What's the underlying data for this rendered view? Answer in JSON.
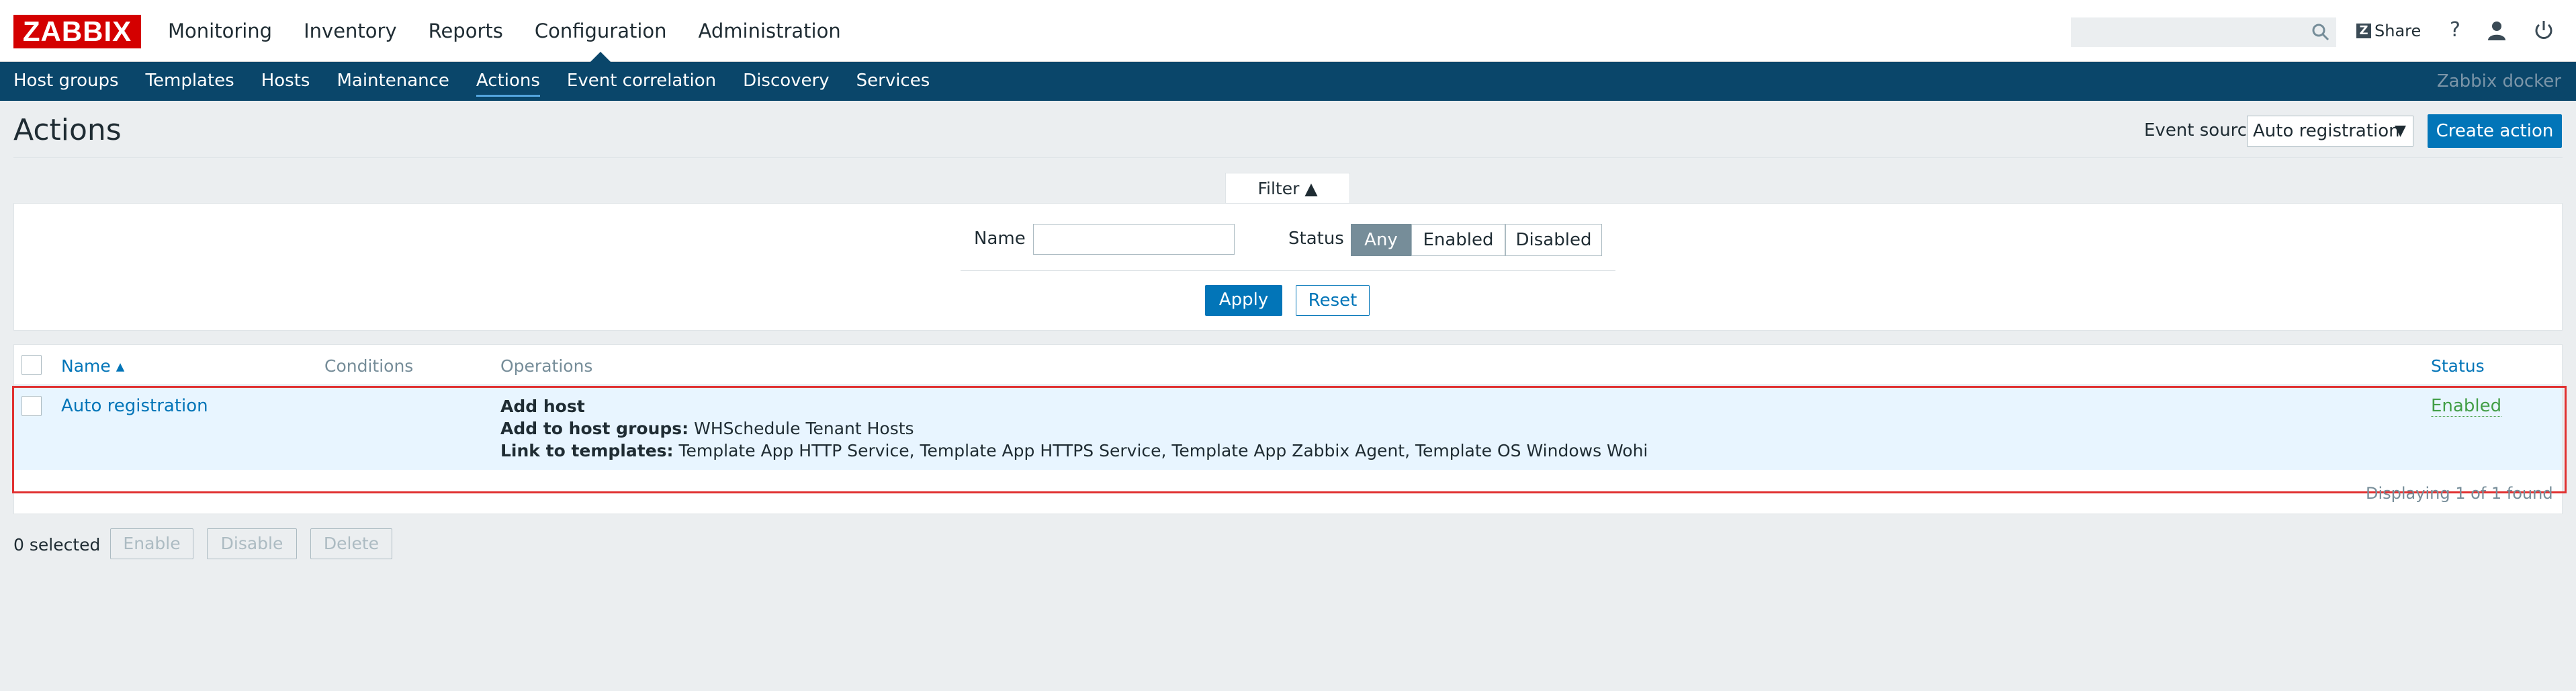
{
  "header": {
    "logo": "ZABBIX",
    "main_nav": [
      "Monitoring",
      "Inventory",
      "Reports",
      "Configuration",
      "Administration"
    ],
    "active_main": "Configuration",
    "search_value": "",
    "share_label": "Share",
    "help_label": "?"
  },
  "sub_nav": {
    "items": [
      "Host groups",
      "Templates",
      "Hosts",
      "Maintenance",
      "Actions",
      "Event correlation",
      "Discovery",
      "Services"
    ],
    "active": "Actions",
    "server_name": "Zabbix docker"
  },
  "page": {
    "title": "Actions",
    "event_source_label": "Event source",
    "event_source_value": "Auto registration",
    "create_button": "Create action"
  },
  "filter": {
    "tab_label": "Filter ▲",
    "name_label": "Name",
    "name_value": "",
    "status_label": "Status",
    "status_options": [
      "Any",
      "Enabled",
      "Disabled"
    ],
    "status_selected": "Any",
    "apply_label": "Apply",
    "reset_label": "Reset"
  },
  "table": {
    "columns": {
      "name": "Name ▴",
      "conditions": "Conditions",
      "operations": "Operations",
      "status": "Status"
    },
    "rows": [
      {
        "name": "Auto registration",
        "conditions": "",
        "op1_label": "Add host",
        "op2_label": "Add to host groups:",
        "op2_value": " WHSchedule Tenant Hosts",
        "op3_label": "Link to templates:",
        "op3_value": " Template App HTTP Service, Template App HTTPS Service, Template App Zabbix Agent, Template OS Windows Wohi",
        "status": "Enabled"
      }
    ],
    "displaying": "Displaying 1 of 1 found"
  },
  "footer": {
    "selected": "0 selected",
    "enable": "Enable",
    "disable": "Disable",
    "delete": "Delete"
  },
  "colors": {
    "brand_red": "#d40000",
    "nav_blue": "#0a466a",
    "primary_blue": "#0275b8",
    "status_green": "#429e47",
    "highlight_red": "#e03030"
  }
}
